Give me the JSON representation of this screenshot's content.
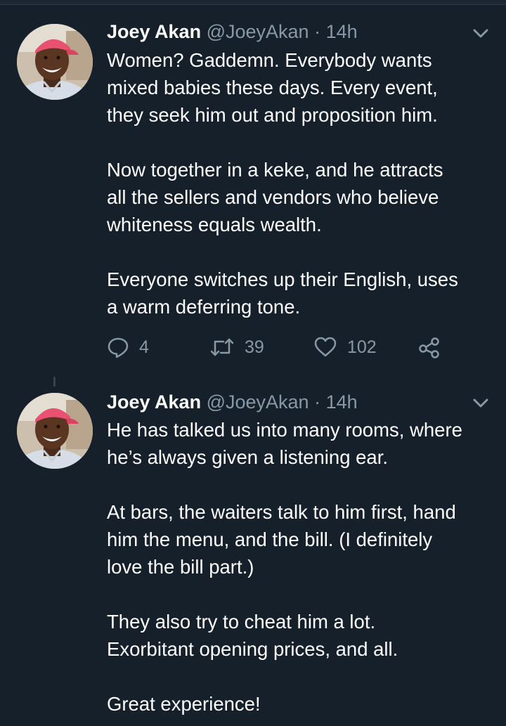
{
  "tweets": [
    {
      "name": "Joey Akan",
      "handle": "@JoeyAkan",
      "separator": "·",
      "time": "14h",
      "paragraphs": [
        [
          "Women? Gaddemn. Everybody wants",
          "mixed babies these days. Every event,",
          "they seek him out and proposition him."
        ],
        [
          "Now together in a keke, and he attracts",
          "all the sellers and vendors who believe",
          "whiteness equals wealth."
        ],
        [
          "Everyone switches up their English, uses",
          "a warm deferring tone."
        ]
      ],
      "actions": {
        "replies": "4",
        "retweets": "39",
        "likes": "102"
      }
    },
    {
      "name": "Joey Akan",
      "handle": "@JoeyAkan",
      "separator": "·",
      "time": "14h",
      "paragraphs": [
        [
          "He has talked us into many rooms, where",
          "he’s always given a listening ear."
        ],
        [
          "At bars, the waiters talk to him first, hand",
          "him the menu, and the bill. (I definitely",
          "love the bill part.)"
        ],
        [
          "They also try to cheat him a lot.",
          "Exorbitant opening prices, and all."
        ],
        [
          "Great experience!"
        ]
      ]
    }
  ],
  "colors": {
    "background": "#15202b",
    "text": "#ffffff",
    "muted": "#8899a6",
    "thread_line": "#38444d"
  },
  "icons": {
    "reply": "reply-icon",
    "retweet": "retweet-icon",
    "like": "heart-icon",
    "share": "share-icon",
    "menu": "chevron-down-icon"
  }
}
